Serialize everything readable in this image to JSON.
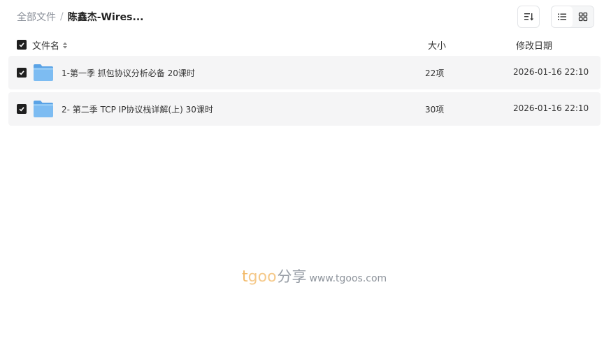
{
  "breadcrumb": {
    "root": "全部文件",
    "separator": "/",
    "current": "陈鑫杰-Wires..."
  },
  "toolbar": {
    "sort_icon": "sort-list-icon",
    "list_view_icon": "list-view-icon",
    "grid_view_icon": "grid-view-icon",
    "active_view": "list"
  },
  "table": {
    "columns": {
      "name": "文件名",
      "size": "大小",
      "date": "修改日期"
    },
    "rows": [
      {
        "name": "1-第一季 抓包协议分析必备 20课时",
        "size": "22项",
        "date": "2026-01-16 22:10",
        "checked": true,
        "icon": "folder-icon"
      },
      {
        "name": "2- 第二季 TCP IP协议栈详解(上) 30课时",
        "size": "30项",
        "date": "2026-01-16 22:10",
        "checked": true,
        "icon": "folder-icon"
      }
    ]
  },
  "watermark": {
    "brand_t": "t",
    "brand_goo": "goo",
    "brand_cn": "分享",
    "url": "www.tgoos.com"
  },
  "colors": {
    "accent_dark": "#1f1f1f",
    "row_bg": "#f5f5f6",
    "folder_blue": "#6fb1ec",
    "watermark_orange": "#f2b968"
  }
}
